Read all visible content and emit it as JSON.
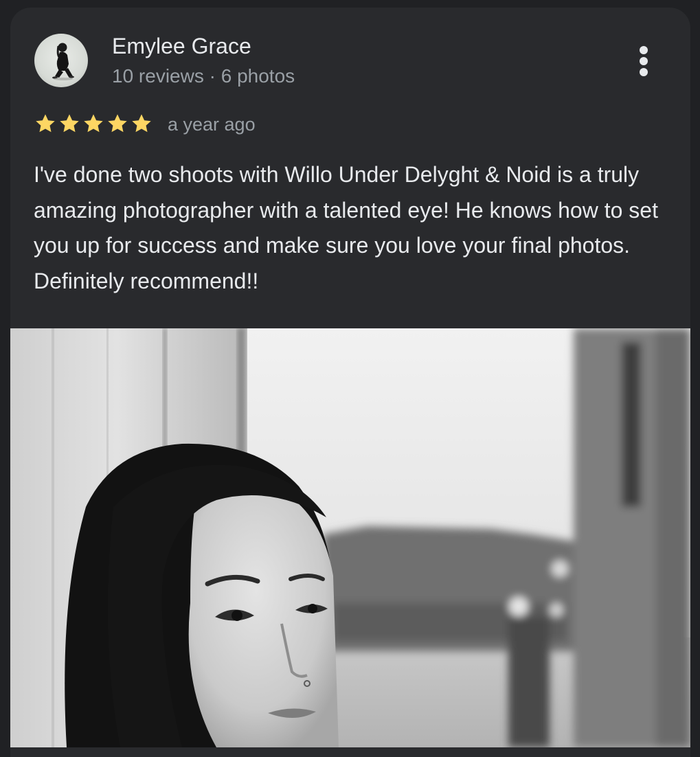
{
  "review": {
    "author_name": "Emylee Grace",
    "author_meta": "10 reviews · 6 photos",
    "rating": 5,
    "rating_max": 5,
    "time_ago": "a year ago",
    "text": "I've done two shoots with Willo Under Delyght & Noid is a truly amazing photographer with a talented eye! He knows how to set you up for success and make sure you love your final photos. Definitely recommend!!",
    "more_icon": "more-vert-icon",
    "star_icon": "star-icon"
  },
  "colors": {
    "page_background": "#202124",
    "card_background": "#292a2d",
    "star": "#fdd663",
    "primary_text": "#e8eaed",
    "secondary_text": "#9aa0a6"
  }
}
